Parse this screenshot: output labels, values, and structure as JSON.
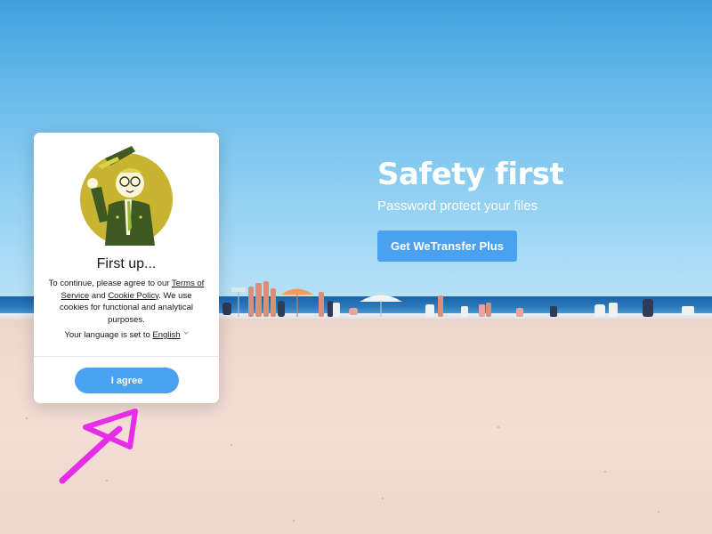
{
  "hero": {
    "title": "Safety first",
    "subtitle": "Password protect your files",
    "cta_label": "Get WeTransfer Plus"
  },
  "consent": {
    "title": "First up...",
    "body_prefix": "To continue, please agree to our",
    "terms_link": "Terms of Service",
    "and_text": "and",
    "cookie_link": "Cookie Policy",
    "body_suffix": ". We use cookies for functional and analytical purposes.",
    "language_prefix": "Your language is set to",
    "language_value": "English",
    "agree_label": "I agree"
  },
  "colors": {
    "accent": "#4aa1f0",
    "annotation": "#e62ee8"
  },
  "icons": {
    "language_toggle": "chevron-down-icon",
    "annotation": "arrow-annotation-icon"
  }
}
